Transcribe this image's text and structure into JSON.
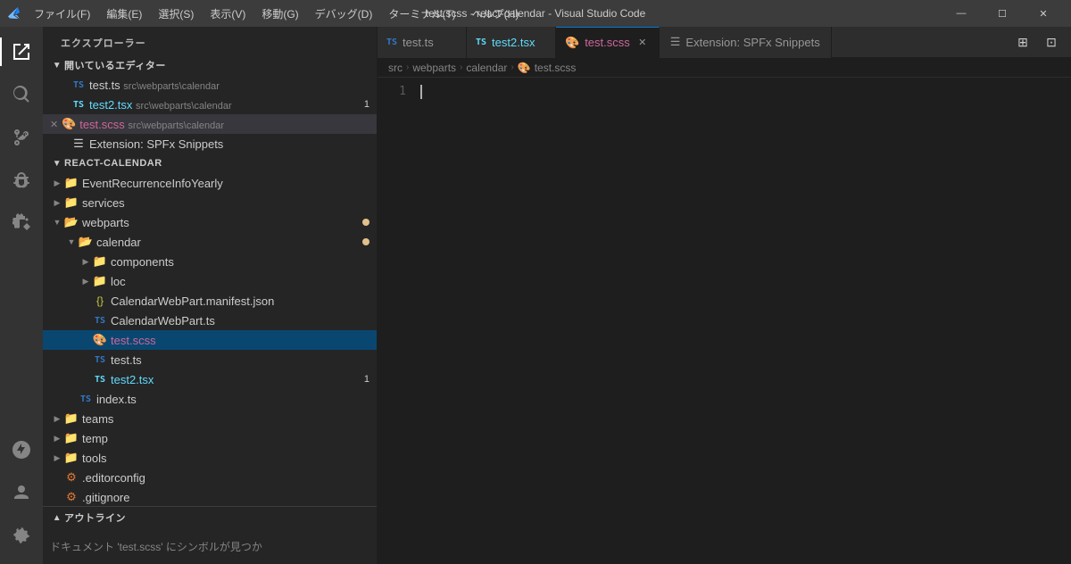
{
  "titlebar": {
    "title": "test.scss - react-calendar - Visual Studio Code",
    "menu": [
      "ファイル(F)",
      "編集(E)",
      "選択(S)",
      "表示(V)",
      "移動(G)",
      "デバッグ(D)",
      "ターミナル(T)",
      "ヘルプ(H)"
    ],
    "controls": [
      "—",
      "☐",
      "✕"
    ]
  },
  "sidebar": {
    "title": "エクスプローラー",
    "sections": {
      "open_editors": "開いているエディター",
      "project": "REACT-CALENDAR",
      "outline": "アウトライン"
    }
  },
  "open_editors": [
    {
      "name": "test.ts",
      "path": "src\\webparts\\calendar",
      "type": "ts",
      "active": false,
      "modified": false
    },
    {
      "name": "test2.tsx",
      "path": "src\\webparts\\calendar",
      "type": "tsx",
      "active": false,
      "modified": false,
      "badge": "1"
    },
    {
      "name": "test.scss",
      "path": "src\\webparts\\calendar",
      "type": "scss",
      "active": true,
      "modified": false
    },
    {
      "name": "Extension: SPFx Snippets",
      "path": "",
      "type": "ext",
      "active": false,
      "modified": false
    }
  ],
  "file_tree": [
    {
      "name": "EventRecurrenceInfoYearly",
      "type": "folder",
      "depth": 1,
      "collapsed": true,
      "arrow": "▶"
    },
    {
      "name": "services",
      "type": "folder",
      "depth": 1,
      "collapsed": true,
      "arrow": "▶"
    },
    {
      "name": "webparts",
      "type": "folder",
      "depth": 1,
      "collapsed": false,
      "arrow": "▼",
      "dot": true
    },
    {
      "name": "calendar",
      "type": "folder",
      "depth": 2,
      "collapsed": false,
      "arrow": "▼",
      "dot": true
    },
    {
      "name": "components",
      "type": "folder",
      "depth": 3,
      "collapsed": true,
      "arrow": "▶"
    },
    {
      "name": "loc",
      "type": "folder",
      "depth": 3,
      "collapsed": true,
      "arrow": "▶"
    },
    {
      "name": "CalendarWebPart.manifest.json",
      "type": "json",
      "depth": 3
    },
    {
      "name": "CalendarWebPart.ts",
      "type": "ts",
      "depth": 3
    },
    {
      "name": "test.scss",
      "type": "scss",
      "depth": 3,
      "active": true
    },
    {
      "name": "test.ts",
      "type": "ts",
      "depth": 3
    },
    {
      "name": "test2.tsx",
      "type": "tsx",
      "depth": 3,
      "badge": "1"
    },
    {
      "name": "index.ts",
      "type": "ts",
      "depth": 2
    },
    {
      "name": "teams",
      "type": "folder",
      "depth": 1,
      "collapsed": true,
      "arrow": "▶"
    },
    {
      "name": "temp",
      "type": "folder-special",
      "depth": 1,
      "collapsed": true,
      "arrow": "▶"
    },
    {
      "name": "tools",
      "type": "folder-special",
      "depth": 1,
      "collapsed": true,
      "arrow": "▶"
    },
    {
      "name": ".editorconfig",
      "type": "config",
      "depth": 1
    },
    {
      "name": ".gitignore",
      "type": "git",
      "depth": 1
    }
  ],
  "tabs": [
    {
      "name": "test.ts",
      "type": "ts",
      "active": false
    },
    {
      "name": "test2.tsx",
      "type": "tsx",
      "active": false
    },
    {
      "name": "test.scss",
      "type": "scss",
      "active": true
    },
    {
      "name": "Extension: SPFx Snippets",
      "type": "ext",
      "active": false
    }
  ],
  "breadcrumb": [
    "src",
    "webparts",
    "calendar",
    "test.scss"
  ],
  "editor": {
    "line_number": "1",
    "content": ""
  },
  "outline": {
    "message": "ドキュメント 'test.scss' にシンボルが見つか"
  }
}
